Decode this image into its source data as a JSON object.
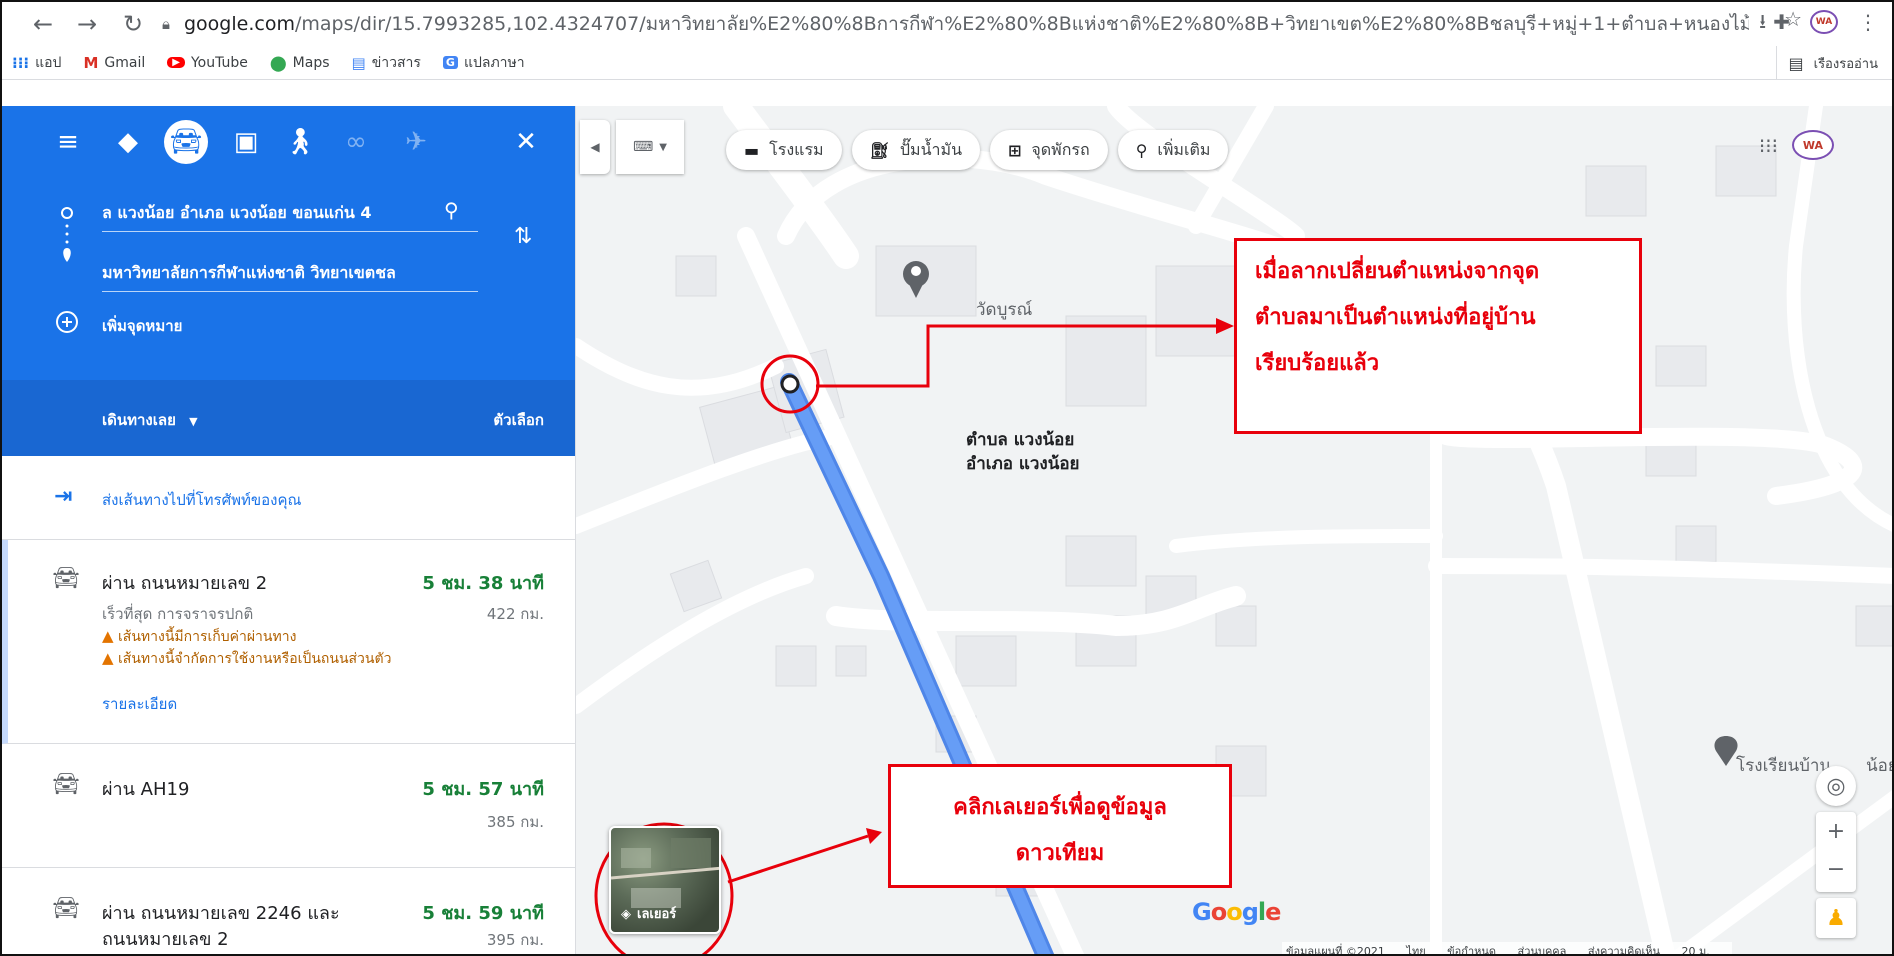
{
  "browser": {
    "url_host": "google.com",
    "url_path": "/maps/dir/15.7993285,102.4324707/มหาวิทยาลัย%E2%80%8Bการกีฬา%E2%80%8Bแห่งชาติ%E2%80%8B+วิทยาเขต%E2%80%8Bชลบุรี+หมู่+1+ตำบล+หนองไม้แดง+อำ...",
    "bookmarks": [
      {
        "label": "แอป",
        "icon": "apps-grid-icon"
      },
      {
        "label": "Gmail",
        "icon": "gmail-icon"
      },
      {
        "label": "YouTube",
        "icon": "youtube-icon"
      },
      {
        "label": "Maps",
        "icon": "maps-pin-icon"
      },
      {
        "label": "ข่าวสาร",
        "icon": "news-icon"
      },
      {
        "label": "แปลภาษา",
        "icon": "translate-icon"
      }
    ],
    "reading_list": "เรืองรออ่าน"
  },
  "directions": {
    "origin_value": "ล แวงน้อย อำเภอ แวงน้อย ขอนแก่น 4",
    "destination_value": "มหาวิทยาลัยการกีฬาแห่งชาติ วิทยาเขตชล",
    "add_destination": "เพิ่มจุดหมาย",
    "depart_now": "เดินทางเลย",
    "options": "ตัวเลือก",
    "send_to_phone": "ส่งเส้นทางไปที่โทรศัพท์ของคุณ"
  },
  "routes": [
    {
      "via": "ผ่าน ถนนหมายเลข 2",
      "time": "5 ชม. 38 นาที",
      "distance": "422 กม.",
      "subtitle": "เร็วที่สุด การจราจรปกติ",
      "warnings": [
        "เส้นทางนี้มีการเก็บค่าผ่านทาง",
        "เส้นทางนี้จำกัดการใช้งานหรือเป็นถนนส่วนตัว"
      ],
      "details": "รายละเอียด"
    },
    {
      "via": "ผ่าน AH19",
      "time": "5 ชม. 57 นาที",
      "distance": "385 กม."
    },
    {
      "via": "ผ่าน ถนนหมายเลข 2246 และ",
      "via2": "ถนนหมายเลข 2",
      "time": "5 ชม. 59 นาที",
      "distance": "395 กม."
    }
  ],
  "map": {
    "chips": [
      {
        "label": "โรงแรม",
        "icon": "hotel-bed-icon"
      },
      {
        "label": "ปั๊มน้ำมัน",
        "icon": "gas-station-icon"
      },
      {
        "label": "จุดพักรถ",
        "icon": "rest-stop-icon"
      },
      {
        "label": "เพิ่มเติม",
        "icon": "search-icon"
      }
    ],
    "poi_temple": "วัดบูรณ์",
    "poi_school": "โรงเรียนบ้าน",
    "poi_school_tail": "น้อย",
    "place_line1": "ตำบล แวงน้อย",
    "place_line2": "อำเภอ แวงน้อย",
    "layers": "เลเยอร์",
    "google": "Google",
    "footer": [
      "ข้อมูลแผนที่ ©2021",
      "ไทย",
      "ข้อกำหนด",
      "ส่วนบุคคล",
      "ส่งความคิดเห็น",
      "20 ม."
    ]
  },
  "annotations": {
    "callout1_lines": [
      "เมื่อลากเปลี่ยนตำแหน่งจากจุด",
      "ตำบลมาเป็นตำแหน่งที่อยู่บ้าน",
      "เรียบร้อยแล้ว"
    ],
    "callout2_lines": [
      "คลิกเลเยอร์เพื่อดูข้อมูล",
      "ดาวเทียม"
    ],
    "accent_color": "#e8000b"
  },
  "colors": {
    "maps_blue": "#1a73e8",
    "route_blue": "#669df6",
    "route_green": "#188038"
  }
}
